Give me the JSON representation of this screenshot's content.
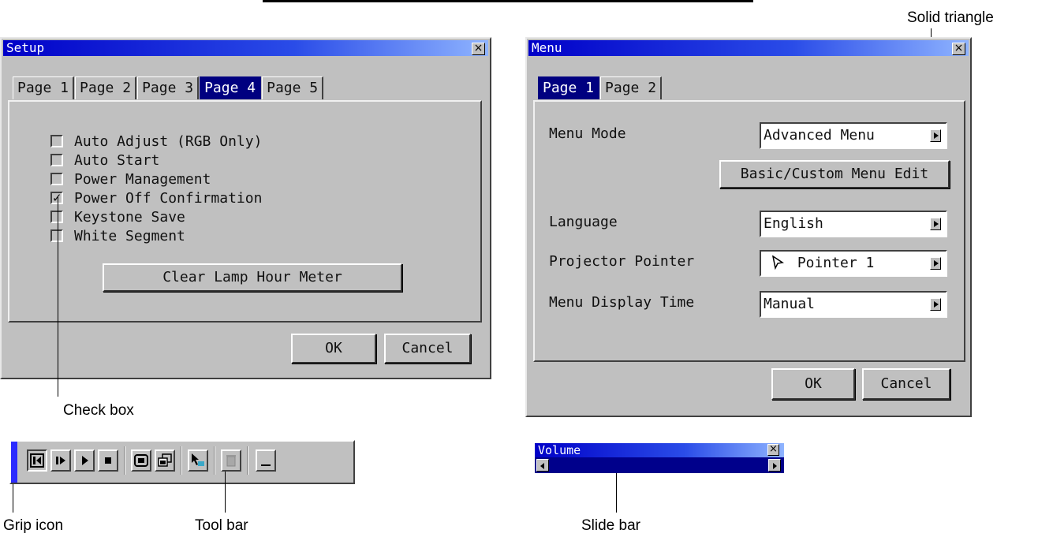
{
  "setup": {
    "title": "Setup",
    "close": "×",
    "tabs": [
      "Page 1",
      "Page 2",
      "Page 3",
      "Page 4",
      "Page 5"
    ],
    "active_tab": "Page 4",
    "options": [
      {
        "label": "Auto Adjust (RGB Only)",
        "checked": false
      },
      {
        "label": "Auto Start",
        "checked": false
      },
      {
        "label": "Power Management",
        "checked": false
      },
      {
        "label": "Power Off Confirmation",
        "checked": true
      },
      {
        "label": "Keystone Save",
        "checked": false
      },
      {
        "label": "White Segment",
        "checked": false
      }
    ],
    "check_mark": "✓",
    "clear_button": "Clear Lamp Hour Meter",
    "ok": "OK",
    "cancel": "Cancel"
  },
  "menu": {
    "title": "Menu",
    "close": "×",
    "tabs": [
      "Page 1",
      "Page 2"
    ],
    "active_tab": "Page 1",
    "menu_mode_label": "Menu Mode",
    "menu_mode_value": "Advanced Menu",
    "edit_button": "Basic/Custom Menu Edit",
    "language_label": "Language",
    "language_value": "English",
    "pointer_label": "Projector Pointer",
    "pointer_value": "Pointer 1",
    "pointer_icon": "arrow-pointer-icon",
    "display_time_label": "Menu Display Time",
    "display_time_value": "Manual",
    "ok": "OK",
    "cancel": "Cancel"
  },
  "volume": {
    "title": "Volume",
    "close": "×"
  },
  "toolbar": {
    "buttons": [
      "skip-back-icon",
      "step-forward-icon",
      "play-icon",
      "stop-icon",
      "fullscreen-icon",
      "copy-window-icon",
      "pointer-icon",
      "trash-icon",
      "minimize-icon"
    ]
  },
  "callouts": {
    "solid_triangle": "Solid triangle",
    "check_box": "Check box",
    "grip_icon": "Grip icon",
    "tool_bar": "Tool bar",
    "slide_bar": "Slide bar"
  },
  "colors": {
    "title_gradient_start": "#0000c8",
    "title_gradient_end": "#8fb4ff",
    "active_tab": "#000080",
    "window_face": "#c0c0c0",
    "grip": "#2b2bff"
  }
}
